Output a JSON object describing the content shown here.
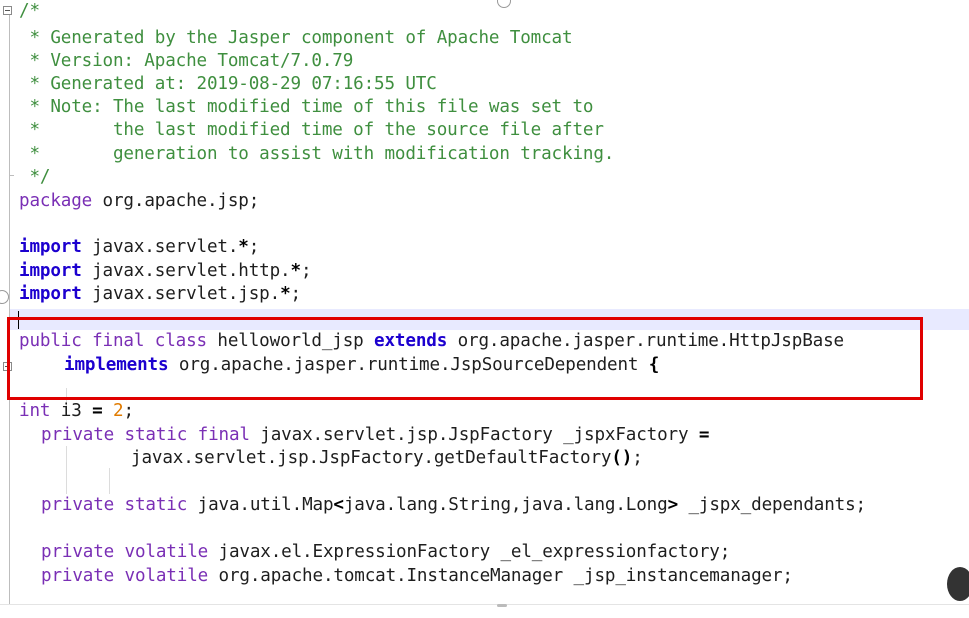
{
  "colors": {
    "comment": "#3f8f3f",
    "keyword": "#7f0055",
    "highlight_box": "#e00000",
    "current_line": "#e8eaff"
  },
  "editor": {
    "language": "java",
    "lines": [
      {
        "id": "l1",
        "text": "/*"
      },
      {
        "id": "l2",
        "text": " * Generated by the Jasper component of Apache Tomcat"
      },
      {
        "id": "l3",
        "text": " * Version: Apache Tomcat/7.0.79"
      },
      {
        "id": "l4",
        "text": " * Generated at: 2019-08-29 07:16:55 UTC"
      },
      {
        "id": "l5",
        "text": " * Note: The last modified time of this file was set to"
      },
      {
        "id": "l6",
        "text": " *       the last modified time of the source file after"
      },
      {
        "id": "l7",
        "text": " *       generation to assist with modification tracking."
      },
      {
        "id": "l8",
        "text": " */"
      },
      {
        "id": "l9",
        "kw": "package",
        "rest": " org.apache.jsp;"
      },
      {
        "id": "l10",
        "kw": "import",
        "rest": " javax.servlet.",
        "star": "*",
        "end": ";"
      },
      {
        "id": "l11",
        "kw": "import",
        "rest": " javax.servlet.http.",
        "star": "*",
        "end": ";"
      },
      {
        "id": "l12",
        "kw": "import",
        "rest": " javax.servlet.jsp.",
        "star": "*",
        "end": ";"
      },
      {
        "id": "l13",
        "kw1": "public final class",
        "name": " helloworld_jsp ",
        "kw2": "extends",
        "rest": " org.apache.jasper.runtime.HttpJspBase"
      },
      {
        "id": "l14",
        "kw": "implements",
        "rest": " org.apache.jasper.runtime.JspSourceDependent ",
        "brace": "{"
      },
      {
        "id": "l15",
        "kw": "int",
        "rest": " i3 ",
        "eq": "=",
        "num": " 2",
        "end": ";"
      },
      {
        "id": "l16",
        "kw": "private static final",
        "rest": " javax.servlet.jsp.JspFactory _jspxFactory ",
        "eq": "="
      },
      {
        "id": "l17",
        "rest": "javax.servlet.jsp.JspFactory.getDefaultFactory",
        "paren": "()",
        "end": ";"
      },
      {
        "id": "l18",
        "kw": "private static",
        "rest": " java.util.Map",
        "lt": "<",
        "mid": "java.lang.String,java.lang.Long",
        "gt": ">",
        "tail": " _jspx_dependants;"
      },
      {
        "id": "l19",
        "kw": "private volatile",
        "rest": " javax.el.ExpressionFactory _el_expressionfactory;"
      },
      {
        "id": "l20",
        "kw": "private volatile",
        "rest": " org.apache.tomcat.InstanceManager _jsp_instancemanager;"
      }
    ]
  }
}
